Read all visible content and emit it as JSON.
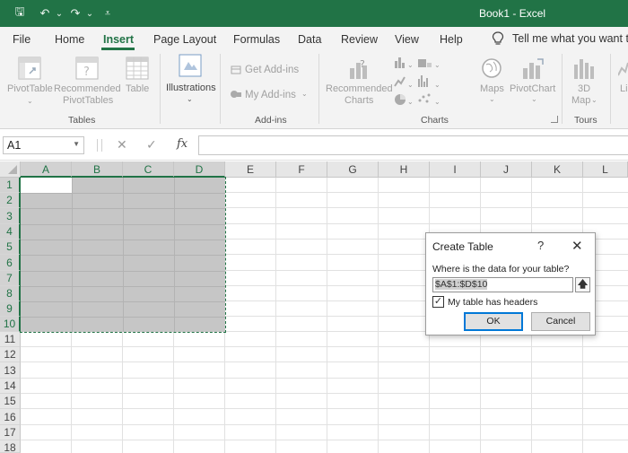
{
  "window": {
    "title": "Book1  -  Excel",
    "colors": {
      "brand": "#217346"
    },
    "quick_access": [
      {
        "name": "save-icon",
        "glyph": "🖫"
      },
      {
        "name": "undo-icon",
        "glyph": "↶"
      },
      {
        "name": "undo-dropdown-icon",
        "glyph": "⌄"
      },
      {
        "name": "redo-icon",
        "glyph": "↷"
      },
      {
        "name": "redo-dropdown-icon",
        "glyph": "⌄"
      },
      {
        "name": "customize-toolbar-icon",
        "glyph": "⩡"
      }
    ]
  },
  "menu": {
    "tabs": [
      "File",
      "Home",
      "Insert",
      "Page Layout",
      "Formulas",
      "Data",
      "Review",
      "View",
      "Help"
    ],
    "active_tab": "Insert",
    "tell_me": "Tell me what you want to"
  },
  "ribbon": {
    "pivottable": "PivotTable",
    "recommended_pivottables": [
      "Recommended",
      "PivotTables"
    ],
    "table": "Table",
    "group_tables": "Tables",
    "illustrations": "Illustrations",
    "get_addins": "Get Add-ins",
    "my_addins": "My Add-ins",
    "group_addins": "Add-ins",
    "recommended_charts": [
      "Recommended",
      "Charts"
    ],
    "maps": "Maps",
    "pivotchart": "PivotChart",
    "group_charts": "Charts",
    "map3d": [
      "3D",
      "Map"
    ],
    "group_tours": "Tours",
    "lines_partial": "Li"
  },
  "formula_bar": {
    "name_box": "A1",
    "cancel_glyph": "✕",
    "enter_glyph": "✓",
    "fx": "fx",
    "formula": ""
  },
  "grid": {
    "columns": [
      "A",
      "B",
      "C",
      "D",
      "E",
      "F",
      "G",
      "H",
      "I",
      "J",
      "K",
      "L"
    ],
    "rows": [
      "1",
      "2",
      "3",
      "4",
      "5",
      "6",
      "7",
      "8",
      "9",
      "10",
      "11",
      "12",
      "13",
      "14",
      "15",
      "16",
      "17",
      "18"
    ],
    "selected_range": "A1:D10"
  },
  "dialog": {
    "title": "Create Table",
    "help": "?",
    "close": "✕",
    "prompt": "Where is the data for your table?",
    "range_value": "$A$1:$D$10",
    "collapse_glyph": "🡅",
    "headers_checkbox_label": "My table has headers",
    "headers_checked": true,
    "check_glyph": "✓",
    "ok_label": "OK",
    "cancel_label": "Cancel"
  }
}
